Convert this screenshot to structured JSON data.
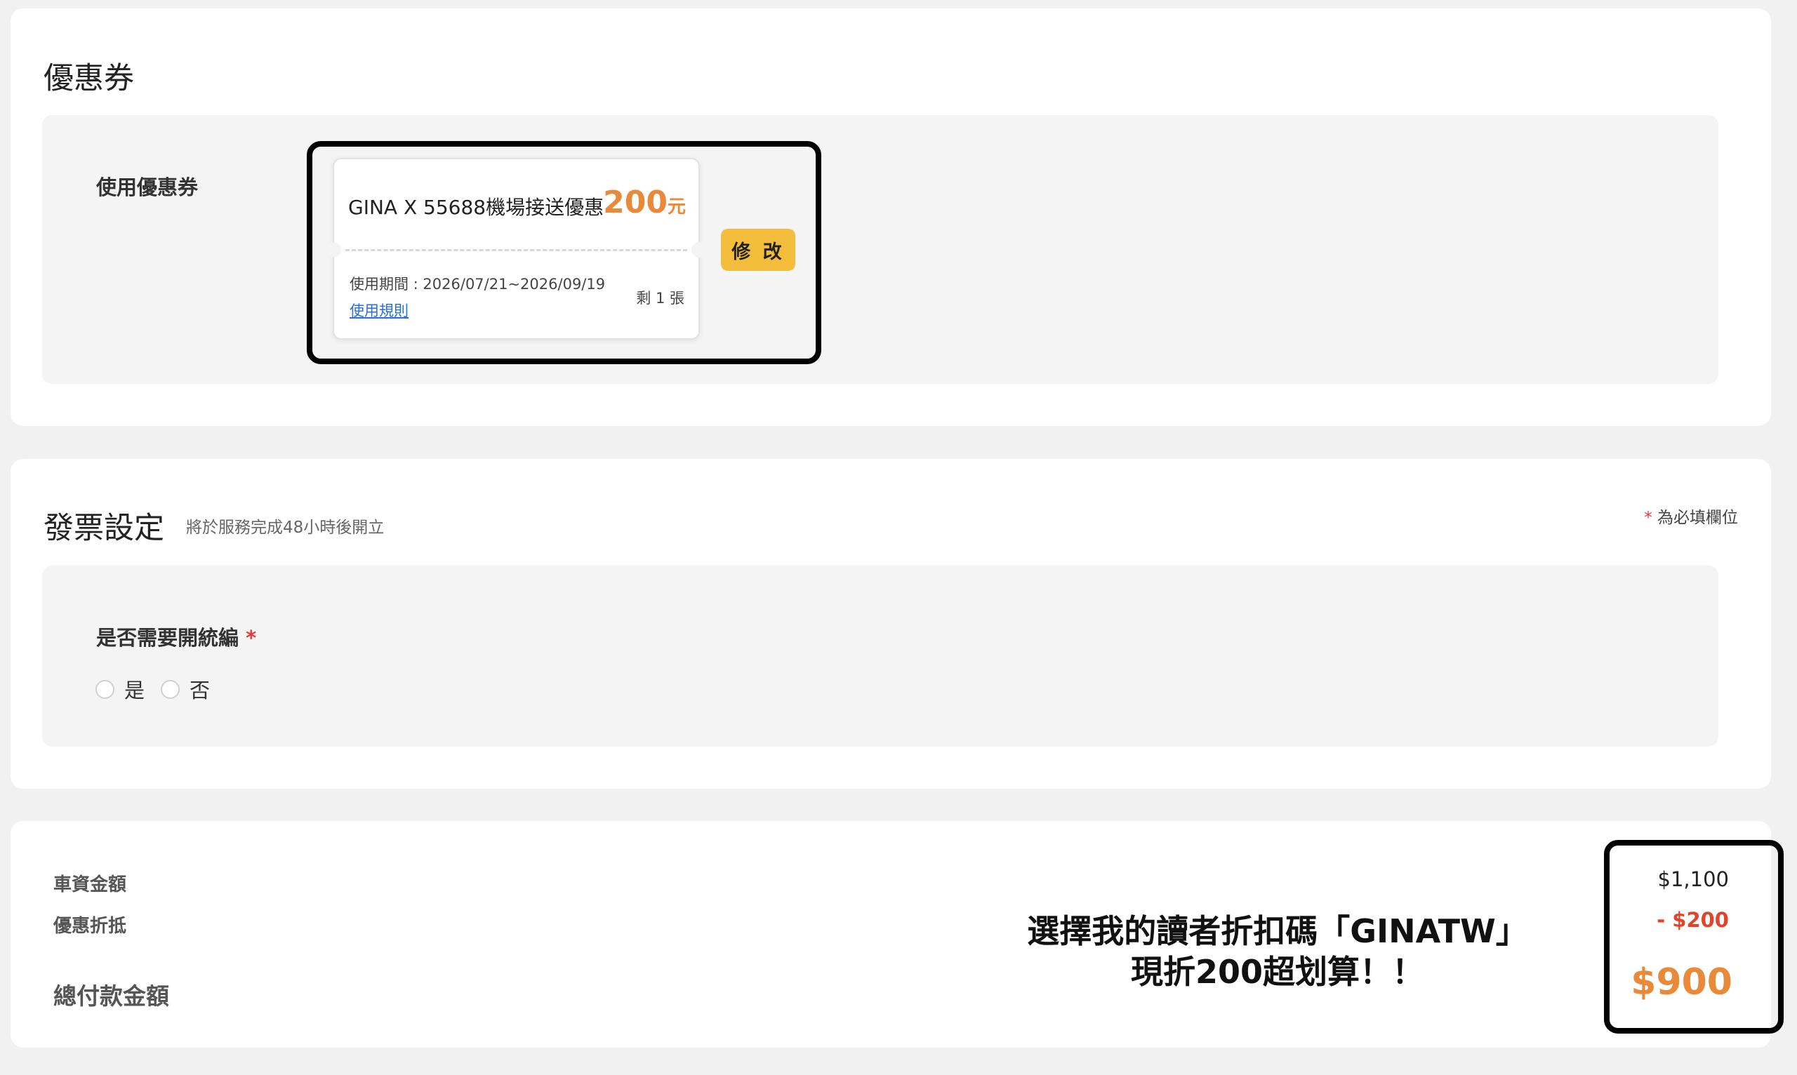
{
  "coupon_section": {
    "title": "優惠券",
    "field_label": "使用優惠券",
    "coupon": {
      "name": "GINA X 55688機場接送優惠",
      "amount": "200",
      "amount_unit": "元",
      "period": "使用期間 : 2026/07/21~2026/09/19",
      "rules_link": "使用規則",
      "remaining": "剩 1 張"
    },
    "edit_button": "修 改"
  },
  "invoice_section": {
    "title": "發票設定",
    "subtitle": "將於服務完成48小時後開立",
    "required_note": "為必填欄位",
    "required_star": "*",
    "question": "是否需要開統編",
    "options": [
      {
        "label": "是",
        "selected": false
      },
      {
        "label": "否",
        "selected": false
      }
    ]
  },
  "summary": {
    "fare_label": "車資金額",
    "discount_label": "優惠折抵",
    "total_label": "總付款金額",
    "fare_value": "$1,100",
    "discount_value": "- $200",
    "total_value": "$900"
  },
  "promo_overlay": {
    "line1": "選擇我的讀者折扣碼「GINATW」",
    "line2": "現折200超划算！！"
  },
  "colors": {
    "accent_orange": "#e88a3a",
    "discount_red": "#e0442c",
    "button_yellow": "#f5bd3c",
    "link_blue": "#2a6fd6",
    "page_bg": "#f1f1f1"
  }
}
